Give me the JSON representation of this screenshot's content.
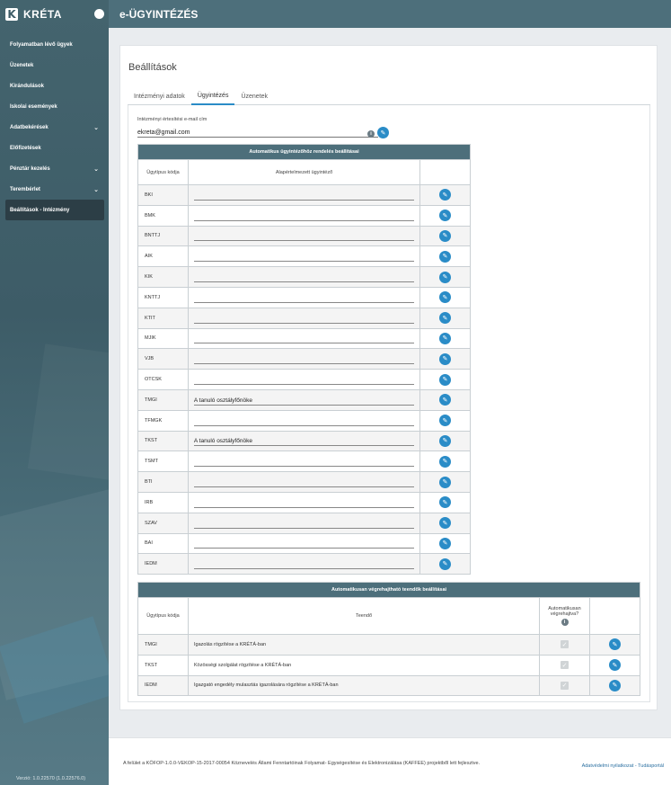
{
  "sidebar": {
    "logo_letter": "K",
    "brand": "KRÉTA",
    "items": [
      {
        "label": "Folyamatban lévő ügyek",
        "chevron": false,
        "active": false
      },
      {
        "label": "Üzenetek",
        "chevron": false,
        "active": false
      },
      {
        "label": "Kirándulások",
        "chevron": false,
        "active": false
      },
      {
        "label": "Iskolai események",
        "chevron": false,
        "active": false
      },
      {
        "label": "Adatbekérések",
        "chevron": true,
        "active": false
      },
      {
        "label": "Előfizetések",
        "chevron": false,
        "active": false
      },
      {
        "label": "Pénztár kezelés",
        "chevron": true,
        "active": false
      },
      {
        "label": "Terembérlet",
        "chevron": true,
        "active": false
      },
      {
        "label": "Beállítások - Intézmény",
        "chevron": false,
        "active": true
      }
    ],
    "version": "Verzió: 1.0.22570 (1.0.22576.0)"
  },
  "header": {
    "title": "e-ÜGYINTÉZÉS"
  },
  "page": {
    "title": "Beállítások",
    "tabs": [
      {
        "label": "Intézményi adatok",
        "active": false
      },
      {
        "label": "Ügyintézés",
        "active": true
      },
      {
        "label": "Üzenetek",
        "active": false
      }
    ]
  },
  "email": {
    "label": "Intézményi értesítési e-mail cím",
    "value": "ekreta@gmail.com",
    "info_symbol": "i"
  },
  "assign_table": {
    "caption": "Automatikus ügyintézőhöz rendelés beállításai",
    "col_code": "Ügytípus kódja",
    "col_default": "Alapértelmezett ügyintéző",
    "rows": [
      {
        "code": "BKI",
        "value": ""
      },
      {
        "code": "BMK",
        "value": ""
      },
      {
        "code": "BNTTJ",
        "value": ""
      },
      {
        "code": "AIK",
        "value": ""
      },
      {
        "code": "KIK",
        "value": ""
      },
      {
        "code": "KNTTJ",
        "value": ""
      },
      {
        "code": "KTIT",
        "value": ""
      },
      {
        "code": "MJIK",
        "value": ""
      },
      {
        "code": "VJB",
        "value": ""
      },
      {
        "code": "OTCSK",
        "value": ""
      },
      {
        "code": "TMGI",
        "value": "A tanuló osztályfőnöke"
      },
      {
        "code": "TFMGK",
        "value": ""
      },
      {
        "code": "TKST",
        "value": "A tanuló osztályfőnöke"
      },
      {
        "code": "TSMT",
        "value": ""
      },
      {
        "code": "BTI",
        "value": ""
      },
      {
        "code": "IRB",
        "value": ""
      },
      {
        "code": "SZAV",
        "value": ""
      },
      {
        "code": "BAI",
        "value": ""
      },
      {
        "code": "IEDM",
        "value": ""
      }
    ]
  },
  "auto_table": {
    "caption": "Automatikusan végrehajtható teendők beállításai",
    "col_code": "Ügytípus kódja",
    "col_task": "Teendő",
    "col_auto": "Automatikusan végrehajtva?",
    "info_symbol": "i",
    "rows": [
      {
        "code": "TMGI",
        "task": "Igazolás rögzítése a KRÉTÁ-ban",
        "checked": true
      },
      {
        "code": "TKST",
        "task": "Közösségi szolgálat rögzítése a KRÉTÁ-ban",
        "checked": true
      },
      {
        "code": "IEDM",
        "task": "Igazgató engedély mulasztás igazolására rögzítése a KRÉTÁ-ban",
        "checked": true
      }
    ]
  },
  "footer": {
    "text": "A felület a KÖFOP-1.0.0-VEKOP-15-2017-00054 Köznevelés Állami Fenntartóinak Folyamat- Egységesítése és Elektronizálása (KAFFEE) projektből lett fejlesztve.",
    "links": "Adatvédelmi nyilatkozat - Tudásportál"
  },
  "colors": {
    "accent": "#2a8cc7",
    "header": "#4d6f7b",
    "sidebar": "#3d5c67"
  }
}
